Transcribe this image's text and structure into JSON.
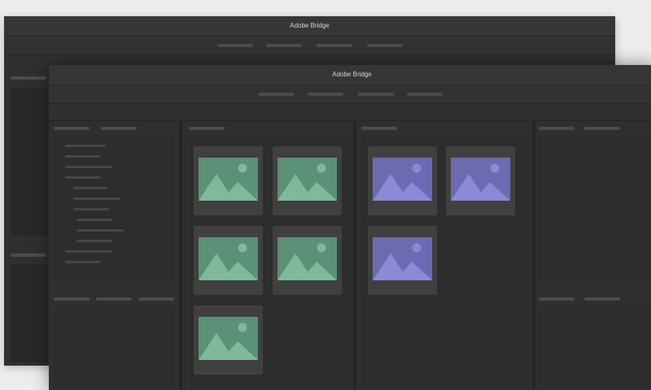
{
  "back_window": {
    "title": "Adobe Bridge"
  },
  "front_window": {
    "title": "Adobe Bridge",
    "menu_items": [
      "",
      "",
      "",
      ""
    ]
  },
  "colors": {
    "image_green_bg": "#5b9177",
    "image_green_fg": "#7fb89b",
    "image_purple_bg": "#6c6bb2",
    "image_purple_fg": "#8a8ad6",
    "panel_bg": "#2d2d2d",
    "window_bg": "#2f2f2f"
  },
  "icons": {
    "thumbnail": "image-icon"
  },
  "content": {
    "green_group_count": 5,
    "purple_group_count": 3
  }
}
